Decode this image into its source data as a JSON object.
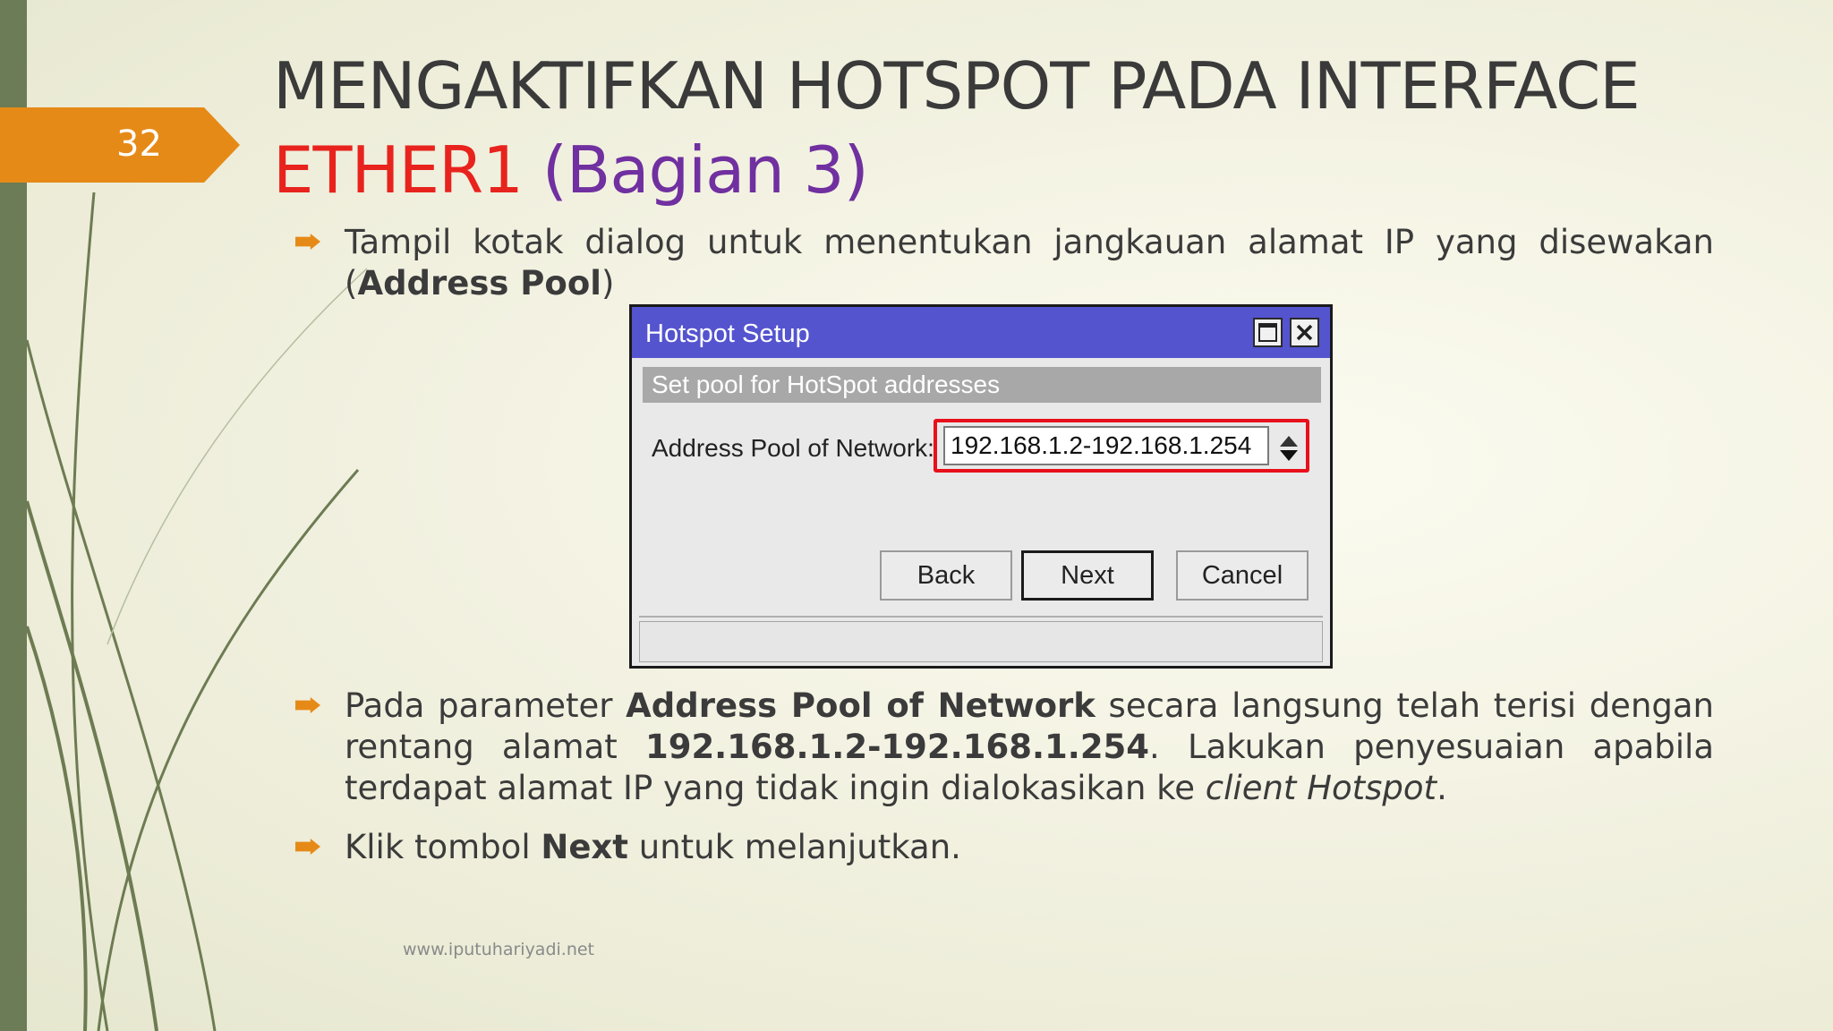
{
  "slide": {
    "number": "32",
    "title_line1": "MENGAKTIFKAN HOTSPOT PADA INTERFACE",
    "title_line2_red": "ETHER1",
    "title_line2_purple": "(Bagian 3)"
  },
  "bullets": {
    "b1_text": "Tampil kotak dialog untuk menentukan jangkauan alamat IP yang disewakan (",
    "b1_bold": "Address Pool",
    "b1_end": ")",
    "b2_text1": "Pada parameter ",
    "b2_bold1": "Address Pool of Network",
    "b2_text2": " secara langsung telah terisi dengan rentang alamat ",
    "b2_bold2": "192.168.1.2-192.168.1.254",
    "b2_text3": ". Lakukan penyesuaian apabila terdapat alamat IP yang tidak ingin dialokasikan ke ",
    "b2_italic": "client Hotspot",
    "b2_end": ".",
    "b3_text1": "Klik tombol ",
    "b3_bold": "Next",
    "b3_text2": " untuk melanjutkan."
  },
  "dialog": {
    "title": "Hotspot Setup",
    "subtitle": "Set pool for HotSpot addresses",
    "field_label": "Address Pool of Network:",
    "field_value": "192.168.1.2-192.168.1.254",
    "back_label": "Back",
    "next_label": "Next",
    "cancel_label": "Cancel"
  },
  "footer": {
    "url": "www.iputuhariyadi.net"
  },
  "colors": {
    "accent_orange": "#e68a17",
    "title_red": "#e8231d",
    "title_purple": "#7030a0",
    "dialog_titlebar": "#5454cf",
    "highlight_red": "#e8101a"
  }
}
